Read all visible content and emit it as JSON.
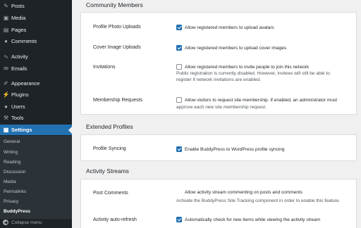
{
  "sidebar": {
    "items": [
      {
        "label": "Posts",
        "icon": "pin-icon"
      },
      {
        "label": "Media",
        "icon": "media-icon"
      },
      {
        "label": "Pages",
        "icon": "pages-icon"
      },
      {
        "label": "Comments",
        "icon": "comments-icon"
      },
      {
        "label": "Activity",
        "icon": "activity-icon"
      },
      {
        "label": "Emails",
        "icon": "email-icon"
      },
      {
        "label": "Appearance",
        "icon": "brush-icon"
      },
      {
        "label": "Plugins",
        "icon": "plugin-icon"
      },
      {
        "label": "Users",
        "icon": "users-icon"
      },
      {
        "label": "Tools",
        "icon": "wrench-icon"
      },
      {
        "label": "Settings",
        "icon": "settings-icon"
      }
    ],
    "submenu": [
      "General",
      "Writing",
      "Reading",
      "Discussion",
      "Media",
      "Permalinks",
      "Privacy",
      "BuddyPress"
    ],
    "collapse_label": "Collapse menu"
  },
  "sections": {
    "community": {
      "title": "Community Members",
      "avatars_label": "Profile Photo Uploads",
      "avatars_option": "Allow registered members to upload avatars",
      "avatars_checked": true,
      "cover_label": "Cover Image Uploads",
      "cover_option": "Allow registered members to upload cover images",
      "cover_checked": true,
      "invites_label": "Invitations",
      "invites_option": "Allow registered members to invite people to join this network",
      "invites_checked": false,
      "invites_desc1": "Public registration is currently disabled. However, invitees will still be able to",
      "invites_desc2": "register if network invitations are enabled.",
      "membership_label": "Membership Requests",
      "membership_option": "Allow visitors to request site membership. If enabled, an administrator must",
      "membership_desc": "approve each new site membership request.",
      "membership_checked": false
    },
    "profiles": {
      "title": "Extended Profiles",
      "sync_label": "Profile Syncing",
      "sync_option": "Enable BuddyPress to WordPress profile syncing",
      "sync_checked": true
    },
    "activity": {
      "title": "Activity Streams",
      "comments_label": "Post Comments",
      "comments_option": "Allow activity stream commenting on posts and comments",
      "comments_desc": "Activate the BuddyPress Site Tracking component in order to enable this feature.",
      "refresh_label": "Activity auto-refresh",
      "refresh_option": "Automatically check for new items while viewing the activity stream",
      "refresh_checked": true
    }
  },
  "colors": {
    "sidebar": "#1d2327",
    "accent": "#2271b1",
    "background": "#f0f0f1"
  }
}
